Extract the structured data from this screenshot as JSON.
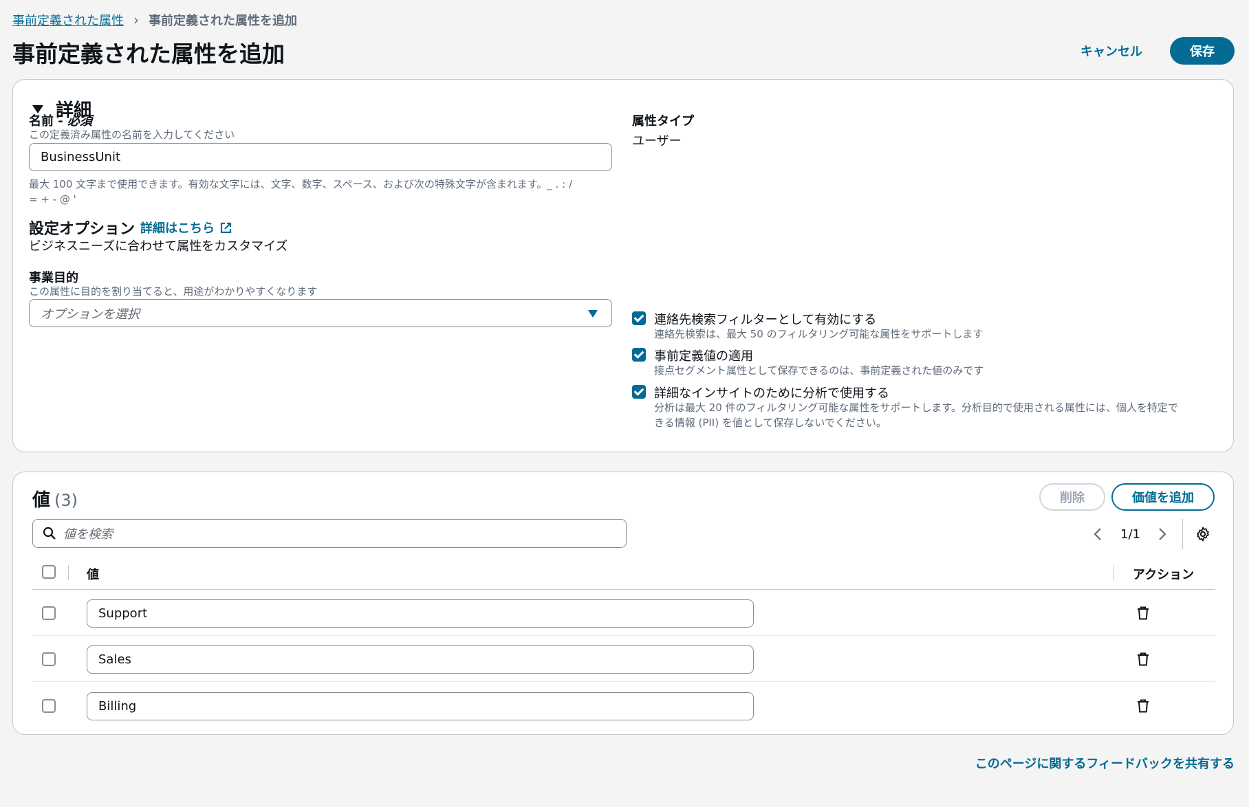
{
  "breadcrumb": {
    "parent": "事前定義された属性",
    "current": "事前定義された属性を追加"
  },
  "header": {
    "title": "事前定義された属性を追加",
    "cancel_label": "キャンセル",
    "save_label": "保存"
  },
  "details": {
    "section_title": "詳細",
    "name": {
      "label": "名前 - ",
      "required": "必須",
      "description": "この定義済み属性の名前を入力してください",
      "value": "BusinessUnit",
      "constraint_line1": "最大 100 文字まで使用できます。有効な文字には、文字、数字、スペース、および次の特殊文字が含まれます。_ . : /",
      "constraint_line2": "= + - @ '"
    },
    "attribute_type": {
      "label": "属性タイプ",
      "value": "ユーザー"
    },
    "config": {
      "title": "設定オプション",
      "learn_more": "詳細はこちら",
      "description": "ビジネスニーズに合わせて属性をカスタマイズ"
    },
    "purpose": {
      "label": "事業目的",
      "description": "この属性に目的を割り当てると、用途がわかりやすくなります",
      "placeholder": "オプションを選択"
    },
    "options": [
      {
        "label": "連絡先検索フィルターとして有効にする",
        "description": "連絡先検索は、最大 50 のフィルタリング可能な属性をサポートします",
        "checked": true
      },
      {
        "label": "事前定義値の適用",
        "description": "接点セグメント属性として保存できるのは、事前定義された値のみです",
        "checked": true
      },
      {
        "label": "詳細なインサイトのために分析で使用する",
        "description_line1": "分析は最大 20 件のフィルタリング可能な属性をサポートします。分析目的で使用される属性には、個人を特定で",
        "description_line2": "きる情報 (PII) を値として保存しないでください。",
        "checked": true
      }
    ]
  },
  "values": {
    "title": "値",
    "count": "(3)",
    "delete_label": "削除",
    "add_label": "価値を追加",
    "search_placeholder": "値を検索",
    "page": "1/1",
    "columns": {
      "value": "値",
      "action": "アクション"
    },
    "rows": [
      "Support",
      "Sales",
      "Billing"
    ]
  },
  "footer": {
    "feedback": "このページに関するフィードバックを共有する"
  },
  "colors": {
    "accent": "#036b94",
    "border": "#c6c6cd"
  }
}
